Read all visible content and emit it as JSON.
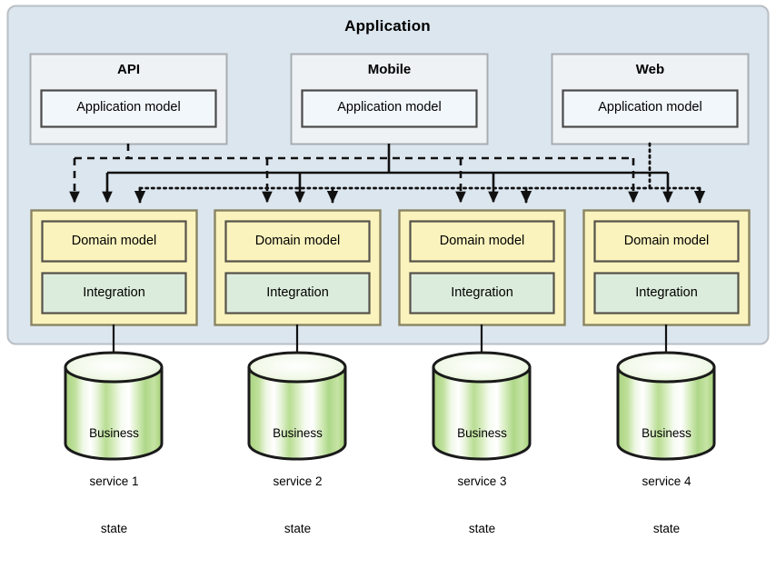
{
  "diagram": {
    "title": "Application",
    "type": "layered-architecture-diagram",
    "colors": {
      "container_fill": "#dce6ef",
      "container_border": "#b9bfc4",
      "channel_fill": "#eef2f5",
      "channel_border": "#a8adb2",
      "appmodel_fill": "#f2f7fc",
      "appmodel_border": "#4a4a4a",
      "service_fill": "#faf3bd",
      "service_border": "#8a8463",
      "domain_fill": "#faf3bd",
      "domain_border": "#55524a",
      "integration_fill": "#dcecdc",
      "integration_border": "#55524a",
      "cylinder_fill": "#b9dd92",
      "cylinder_highlight": "#f4faee",
      "cylinder_border": "#1a1a1a",
      "connector": "#111111"
    }
  },
  "channels": [
    {
      "title": "API",
      "model_label": "Application model",
      "line_style": "dashed"
    },
    {
      "title": "Mobile",
      "model_label": "Application model",
      "line_style": "solid"
    },
    {
      "title": "Web",
      "model_label": "Application model",
      "line_style": "dotted"
    }
  ],
  "services": [
    {
      "domain_label": "Domain model",
      "integration_label": "Integration"
    },
    {
      "domain_label": "Domain model",
      "integration_label": "Integration"
    },
    {
      "domain_label": "Domain model",
      "integration_label": "Integration"
    },
    {
      "domain_label": "Domain model",
      "integration_label": "Integration"
    }
  ],
  "datastores": [
    {
      "line1": "Business",
      "line2": "service 1",
      "line3": "state"
    },
    {
      "line1": "Business",
      "line2": "service 2",
      "line3": "state"
    },
    {
      "line1": "Business",
      "line2": "service 3",
      "line3": "state"
    },
    {
      "line1": "Business",
      "line2": "service 4",
      "line3": "state"
    }
  ]
}
